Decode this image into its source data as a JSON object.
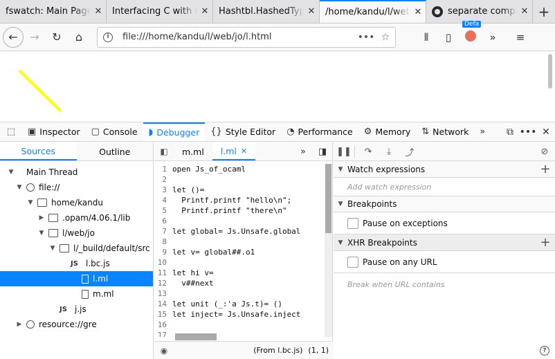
{
  "tabs": [
    {
      "title": "fswatch: Main Page",
      "active": false
    },
    {
      "title": "Interfacing C with OCaml",
      "active": false
    },
    {
      "title": "Hashtbl.HashedType",
      "active": false
    },
    {
      "title": "/home/kandu/l/web/jo/l.html",
      "active": true
    },
    {
      "title": "separate compilation",
      "active": false,
      "icon": "github-icon"
    }
  ],
  "newtab_label": "+",
  "url": "file:///home/kandu/l/web/jo/l.html",
  "extension_badge": "Defa",
  "page_line_color": "#ffff00",
  "devtools": {
    "tools": [
      {
        "label": "Inspector",
        "icon": "inspector-icon"
      },
      {
        "label": "Console",
        "icon": "console-icon"
      },
      {
        "label": "Debugger",
        "icon": "debugger-icon",
        "active": true
      },
      {
        "label": "Style Editor",
        "icon": "style-editor-icon"
      },
      {
        "label": "Performance",
        "icon": "performance-icon"
      },
      {
        "label": "Memory",
        "icon": "memory-icon"
      },
      {
        "label": "Network",
        "icon": "network-icon"
      }
    ]
  },
  "sources_tabs": {
    "sources": "Sources",
    "outline": "Outline"
  },
  "tree": [
    {
      "label": "Main Thread",
      "depth": 0,
      "arrow": "open",
      "icon": "thread"
    },
    {
      "label": "file://",
      "depth": 1,
      "arrow": "open",
      "icon": "globe"
    },
    {
      "label": "home/kandu",
      "depth": 2,
      "arrow": "open",
      "icon": "folder"
    },
    {
      "label": ".opam/4.06.1/lib",
      "depth": 3,
      "arrow": "closed",
      "icon": "folder"
    },
    {
      "label": "l/web/jo",
      "depth": 3,
      "arrow": "open",
      "icon": "folder"
    },
    {
      "label": "l/_build/default/src",
      "depth": 4,
      "arrow": "open",
      "icon": "folder"
    },
    {
      "label": "l.bc.js",
      "depth": 5,
      "arrow": "",
      "icon": "js"
    },
    {
      "label": "l.ml",
      "depth": 6,
      "arrow": "",
      "icon": "file",
      "selected": true
    },
    {
      "label": "m.ml",
      "depth": 6,
      "arrow": "",
      "icon": "file"
    },
    {
      "label": "j.js",
      "depth": 4,
      "arrow": "",
      "icon": "js"
    },
    {
      "label": "resource://gre",
      "depth": 1,
      "arrow": "closed",
      "icon": "globe"
    }
  ],
  "editor_tabs": [
    {
      "label": "m.ml",
      "active": false
    },
    {
      "label": "l.ml",
      "active": true,
      "close": "✕"
    }
  ],
  "code_lines": [
    {
      "n": "1",
      "text": "open Js_of_ocaml"
    },
    {
      "n": "2",
      "text": ""
    },
    {
      "n": "3",
      "text": "let ()="
    },
    {
      "n": "4",
      "text": "  Printf.printf \"hello\\n\";"
    },
    {
      "n": "5",
      "text": "  Printf.printf \"there\\n\""
    },
    {
      "n": "6",
      "text": ""
    },
    {
      "n": "7",
      "text": "let global= Js.Unsafe.global"
    },
    {
      "n": "8",
      "text": ""
    },
    {
      "n": "9",
      "text": "let v= global##.o1"
    },
    {
      "n": "10",
      "text": ""
    },
    {
      "n": "11",
      "text": "let hi v="
    },
    {
      "n": "12",
      "text": "  v##next"
    },
    {
      "n": "13",
      "text": ""
    },
    {
      "n": "14",
      "text": "let unit (_:'a Js.t)= ()"
    },
    {
      "n": "15",
      "text": "let inject= Js.Unsafe.inject"
    },
    {
      "n": "16",
      "text": ""
    },
    {
      "n": "17",
      "text": ""
    }
  ],
  "editor_footer": {
    "from": "(From l.bc.js)",
    "position": "(1, 1)"
  },
  "right_pane": {
    "watch": {
      "title": "Watch expressions",
      "placeholder": "Add watch expression"
    },
    "breakpoints": {
      "title": "Breakpoints",
      "pause_exceptions": "Pause on exceptions"
    },
    "xhr": {
      "title": "XHR Breakpoints",
      "pause_any_url": "Pause on any URL",
      "placeholder": "Break when URL contains"
    }
  }
}
